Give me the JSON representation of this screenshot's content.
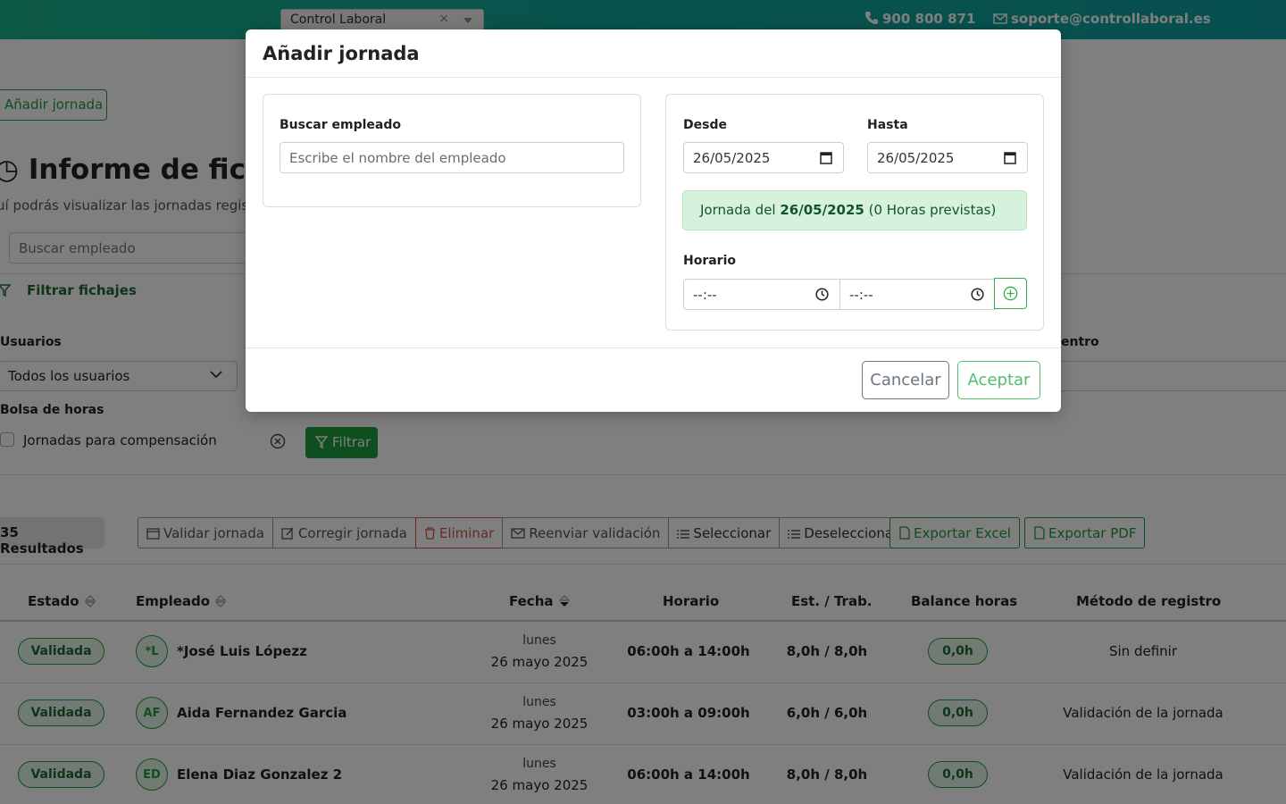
{
  "topbar": {
    "app_select": "Control Laboral",
    "phone": "900 800 871",
    "email": "soporte@controllaboral.es"
  },
  "page": {
    "add_button": "Añadir jornada",
    "title": "Informe de fichaje",
    "subtitle": "uí podrás visualizar las jornadas registr",
    "search_placeholder": "Buscar empleado",
    "filter_heading": "Filtrar fichajes",
    "usuarios_label": "Usuarios",
    "usuarios_value": "Todos los usuarios",
    "centro_label": "entro",
    "bolsa_label": "Bolsa de horas",
    "compensacion_label": "Jornadas para compensación",
    "filtrar_button": "Filtrar",
    "results": "35 Resultados",
    "actions": [
      "Validar jornada",
      "Corregir jornada",
      "Eliminar",
      "Reenviar validación",
      "Seleccionar",
      "Deseleccionar"
    ],
    "export_excel": "Exportar Excel",
    "export_pdf": "Exportar PDF"
  },
  "table": {
    "headers": {
      "estado": "Estado",
      "empleado": "Empleado",
      "fecha": "Fecha",
      "horario": "Horario",
      "est_trab": "Est. / Trab.",
      "balance": "Balance horas",
      "metodo": "Método de registro"
    },
    "rows": [
      {
        "estado": "Validada",
        "initials": "*L",
        "name": "*José Luis Lópezz",
        "day": "lunes",
        "date": "26 mayo 2025",
        "horario": "06:00h a 14:00h",
        "est_trab": "8,0h / 8,0h",
        "balance": "0,0h",
        "metodo": "Sin definir"
      },
      {
        "estado": "Validada",
        "initials": "AF",
        "name": "Aida Fernandez Garcia",
        "day": "lunes",
        "date": "26 mayo 2025",
        "horario": "03:00h a 09:00h",
        "est_trab": "6,0h / 6,0h",
        "balance": "0,0h",
        "metodo": "Validación de la jornada"
      },
      {
        "estado": "Validada",
        "initials": "ED",
        "name": "Elena Diaz Gonzalez 2",
        "day": "lunes",
        "date": "26 mayo 2025",
        "horario": "06:00h a 14:00h",
        "est_trab": "8,0h / 8,0h",
        "balance": "0,0h",
        "metodo": "Validación de la jornada"
      }
    ]
  },
  "modal": {
    "title": "Añadir jornada",
    "buscar_label": "Buscar empleado",
    "buscar_placeholder": "Escribe el nombre del empleado",
    "desde_label": "Desde",
    "desde_value": "26/05/2025",
    "hasta_label": "Hasta",
    "hasta_value": "26/05/2025",
    "alert_prefix": "Jornada del ",
    "alert_date": "26/05/2025",
    "alert_suffix": " (0 Horas previstas)",
    "horario_label": "Horario",
    "time_start": "--:--",
    "time_end": "--:--",
    "cancel": "Cancelar",
    "accept": "Aceptar"
  },
  "colors": {
    "brand_green": "#1f9d3a",
    "topbar_teal": "#11a89a",
    "alert_bg": "#d7f2dc"
  }
}
